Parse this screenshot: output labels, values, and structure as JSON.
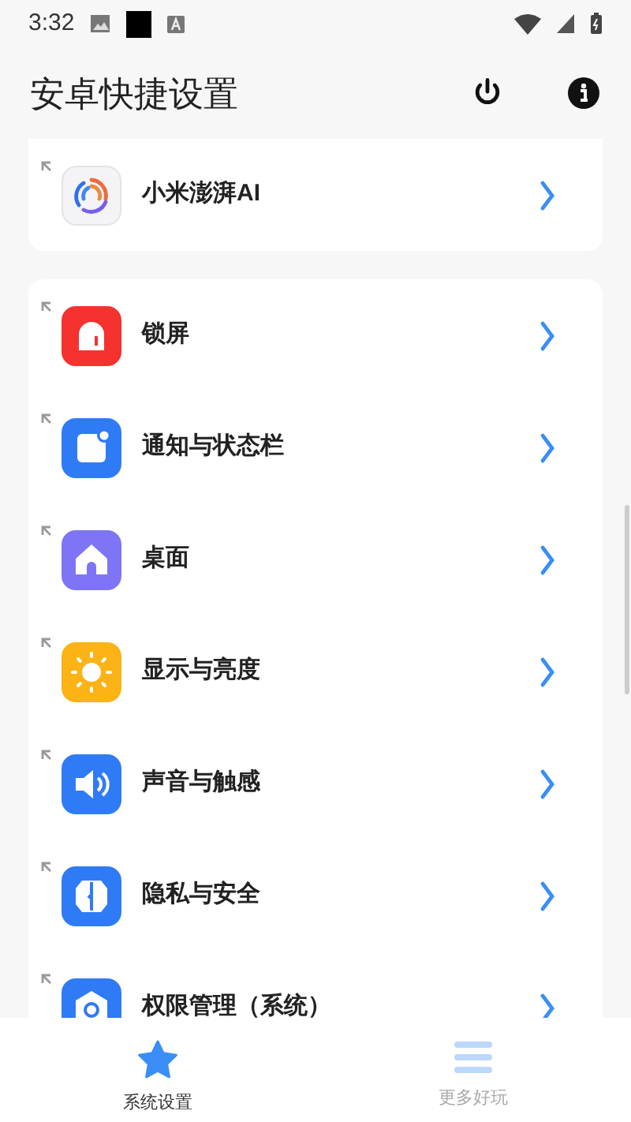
{
  "status_bar": {
    "time": "3:32"
  },
  "app_bar": {
    "title": "安卓快捷设置"
  },
  "cards": [
    {
      "items": [
        {
          "label": "小米澎湃AI",
          "kind": "swirl"
        }
      ]
    },
    {
      "items": [
        {
          "label": "锁屏",
          "kind": "lock"
        },
        {
          "label": "通知与状态栏",
          "kind": "notify"
        },
        {
          "label": "桌面",
          "kind": "home"
        },
        {
          "label": "显示与亮度",
          "kind": "sun"
        },
        {
          "label": "声音与触感",
          "kind": "sound"
        },
        {
          "label": "隐私与安全",
          "kind": "privacy"
        },
        {
          "label": "权限管理（系统）",
          "kind": "permission"
        }
      ]
    }
  ],
  "tabs": [
    {
      "label": "系统设置",
      "kind": "star",
      "selected": true
    },
    {
      "label": "更多好玩",
      "kind": "menu",
      "selected": false
    }
  ]
}
